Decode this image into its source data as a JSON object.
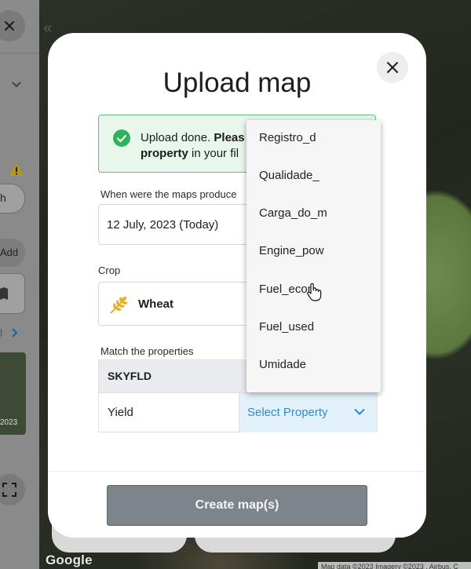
{
  "map": {
    "logo": "Google",
    "attribution": "Map data ©2023 Imagery ©2023 , Airbus, C"
  },
  "sidebar": {
    "partial_labels": [
      "h",
      "Add",
      "l",
      "2023"
    ]
  },
  "modal": {
    "title": "Upload map",
    "success": {
      "text_1": "Upload done. ",
      "text_bold_1": "Pleas",
      "text_bold_2": "property",
      "text_2": " in your fil"
    },
    "date_field": {
      "label": "When were the maps produce",
      "value": "12 July, 2023 (Today)"
    },
    "crop_field": {
      "label": "Crop",
      "value": "Wheat"
    },
    "match": {
      "label": "Match the properties",
      "header": "SKYFLD",
      "rows": [
        {
          "name": "Yield",
          "select_placeholder": "Select Property"
        }
      ]
    },
    "create_button": "Create map(s)"
  },
  "dropdown": {
    "options": [
      "Registro_d",
      "Qualidade_",
      "Carga_do_m",
      "Engine_pow",
      "Fuel_econ",
      "Fuel_used",
      "Umidade"
    ]
  },
  "colors": {
    "accent_blue": "#2b8ad0",
    "success_green": "#2fb25a",
    "button_disabled": "#7d848a"
  }
}
